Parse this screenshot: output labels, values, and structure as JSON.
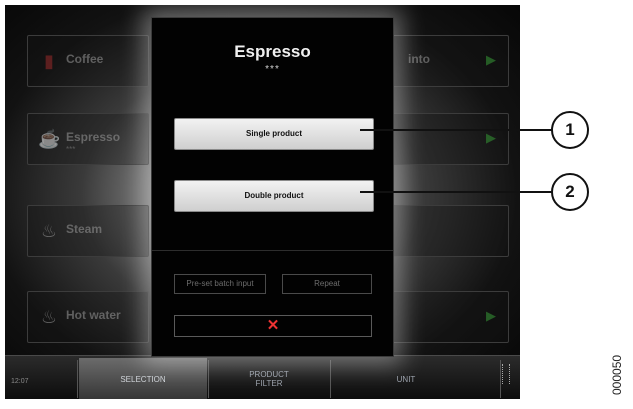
{
  "background_tiles": [
    {
      "label": "Coffee",
      "sub": "",
      "icon": "coffee-cup-icon"
    },
    {
      "label": "Espresso",
      "sub": "***",
      "icon": "espresso-cup-icon"
    },
    {
      "label": "Steam",
      "sub": "",
      "icon": "steam-icon"
    },
    {
      "label": "Hot water",
      "sub": "",
      "icon": "hot-water-icon"
    },
    {
      "label": "into",
      "sub": "",
      "icon": ""
    }
  ],
  "dialog": {
    "title": "Espresso",
    "stars": "***",
    "single_label": "Single product",
    "double_label": "Double product",
    "preset_label": "Pre-set batch input",
    "repeat_label": "Repeat",
    "cancel_symbol": "✕"
  },
  "statusbar": {
    "time": "12:07",
    "tabs": [
      {
        "label": "SELECTION",
        "active": true
      },
      {
        "label": "PRODUCT\nFILTER",
        "active": false
      },
      {
        "label": "UNIT",
        "active": false
      }
    ]
  },
  "callouts": [
    "1",
    "2"
  ],
  "figure_code": "000050",
  "colors": {
    "cancel": "#ee3333",
    "play": "#2f7d2f"
  }
}
